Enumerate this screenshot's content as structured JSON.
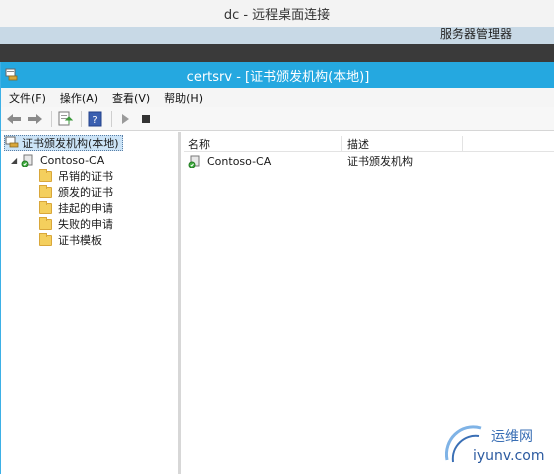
{
  "rdp": {
    "title": "dc - 远程桌面连接"
  },
  "server_manager": {
    "title": "服务器管理器"
  },
  "window": {
    "title": "certsrv - [证书颁发机构(本地)]"
  },
  "menu": [
    {
      "label": "文件(F)"
    },
    {
      "label": "操作(A)"
    },
    {
      "label": "查看(V)"
    },
    {
      "label": "帮助(H)"
    }
  ],
  "toolbar": {
    "icons": [
      "back-arrow-icon",
      "forward-arrow-icon",
      "export-list-icon",
      "help-icon",
      "start-service-icon",
      "stop-service-icon"
    ]
  },
  "tree": {
    "root": "证书颁发机构(本地)",
    "ca": "Contoso-CA",
    "folders": [
      "吊销的证书",
      "颁发的证书",
      "挂起的申请",
      "失败的申请",
      "证书模板"
    ]
  },
  "list": {
    "columns": [
      "名称",
      "描述"
    ],
    "rows": [
      {
        "name": "Contoso-CA",
        "description": "证书颁发机构"
      }
    ]
  },
  "watermark": {
    "brand_cn": "运维网",
    "brand_url": "iyunv.com"
  },
  "colors": {
    "titlebar": "#25a8e0",
    "folder": "#f4cf5d",
    "selection": "#cce4f7"
  }
}
